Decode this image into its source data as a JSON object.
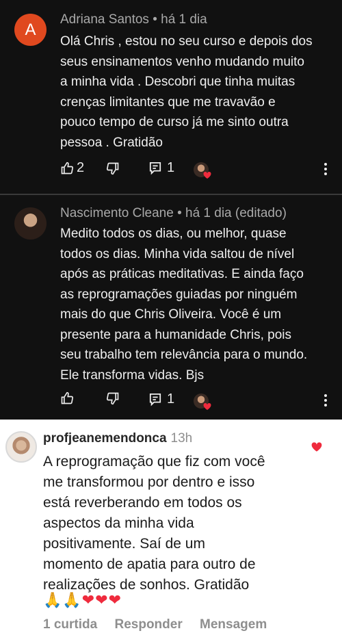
{
  "yt_comments": [
    {
      "avatar_letter": "A",
      "header": "Adriana Santos • há 1 dia",
      "text": "Olá Chris , estou no seu curso e depois dos\nseus ensinamentos venho mudando muito\na minha vida . Descobri que tinha muitas\ncrenças limitantes que me travavão e\npouco tempo de curso já me sinto outra\npessoa  . Gratidão",
      "likes": "2",
      "replies": "1"
    },
    {
      "header": "Nascimento Cleane • há 1 dia (editado)",
      "text": "Medito todos os dias, ou melhor, quase\ntodos os dias. Minha vida saltou de nível\napós as práticas meditativas. E ainda faço\nas reprogramações guiadas por ninguém\nmais do que Chris Oliveira. Você é um\npresente para a humanidade Chris, pois\nseu trabalho tem relevância para o mundo.\nEle transforma vidas. Bjs",
      "likes": "",
      "replies": "1"
    }
  ],
  "ig_comment": {
    "username": "profjeanemendonca",
    "time": "13h",
    "text": "A reprogramação que fiz com você\nme transformou por dentro e isso\nestá reverberando em todos os\naspectos da minha vida\npositivamente. Saí de um\nmomento de apatia para outro de\nrealizações de sonhos. Gratidão",
    "emojis": "🙏🙏❤❤❤",
    "likes_label": "1 curtida",
    "reply_label": "Responder",
    "message_label": "Mensagem"
  },
  "colors": {
    "yt_background": "#111111",
    "avatar_a": "#e0491f",
    "heart_red": "#ef2b3d"
  }
}
